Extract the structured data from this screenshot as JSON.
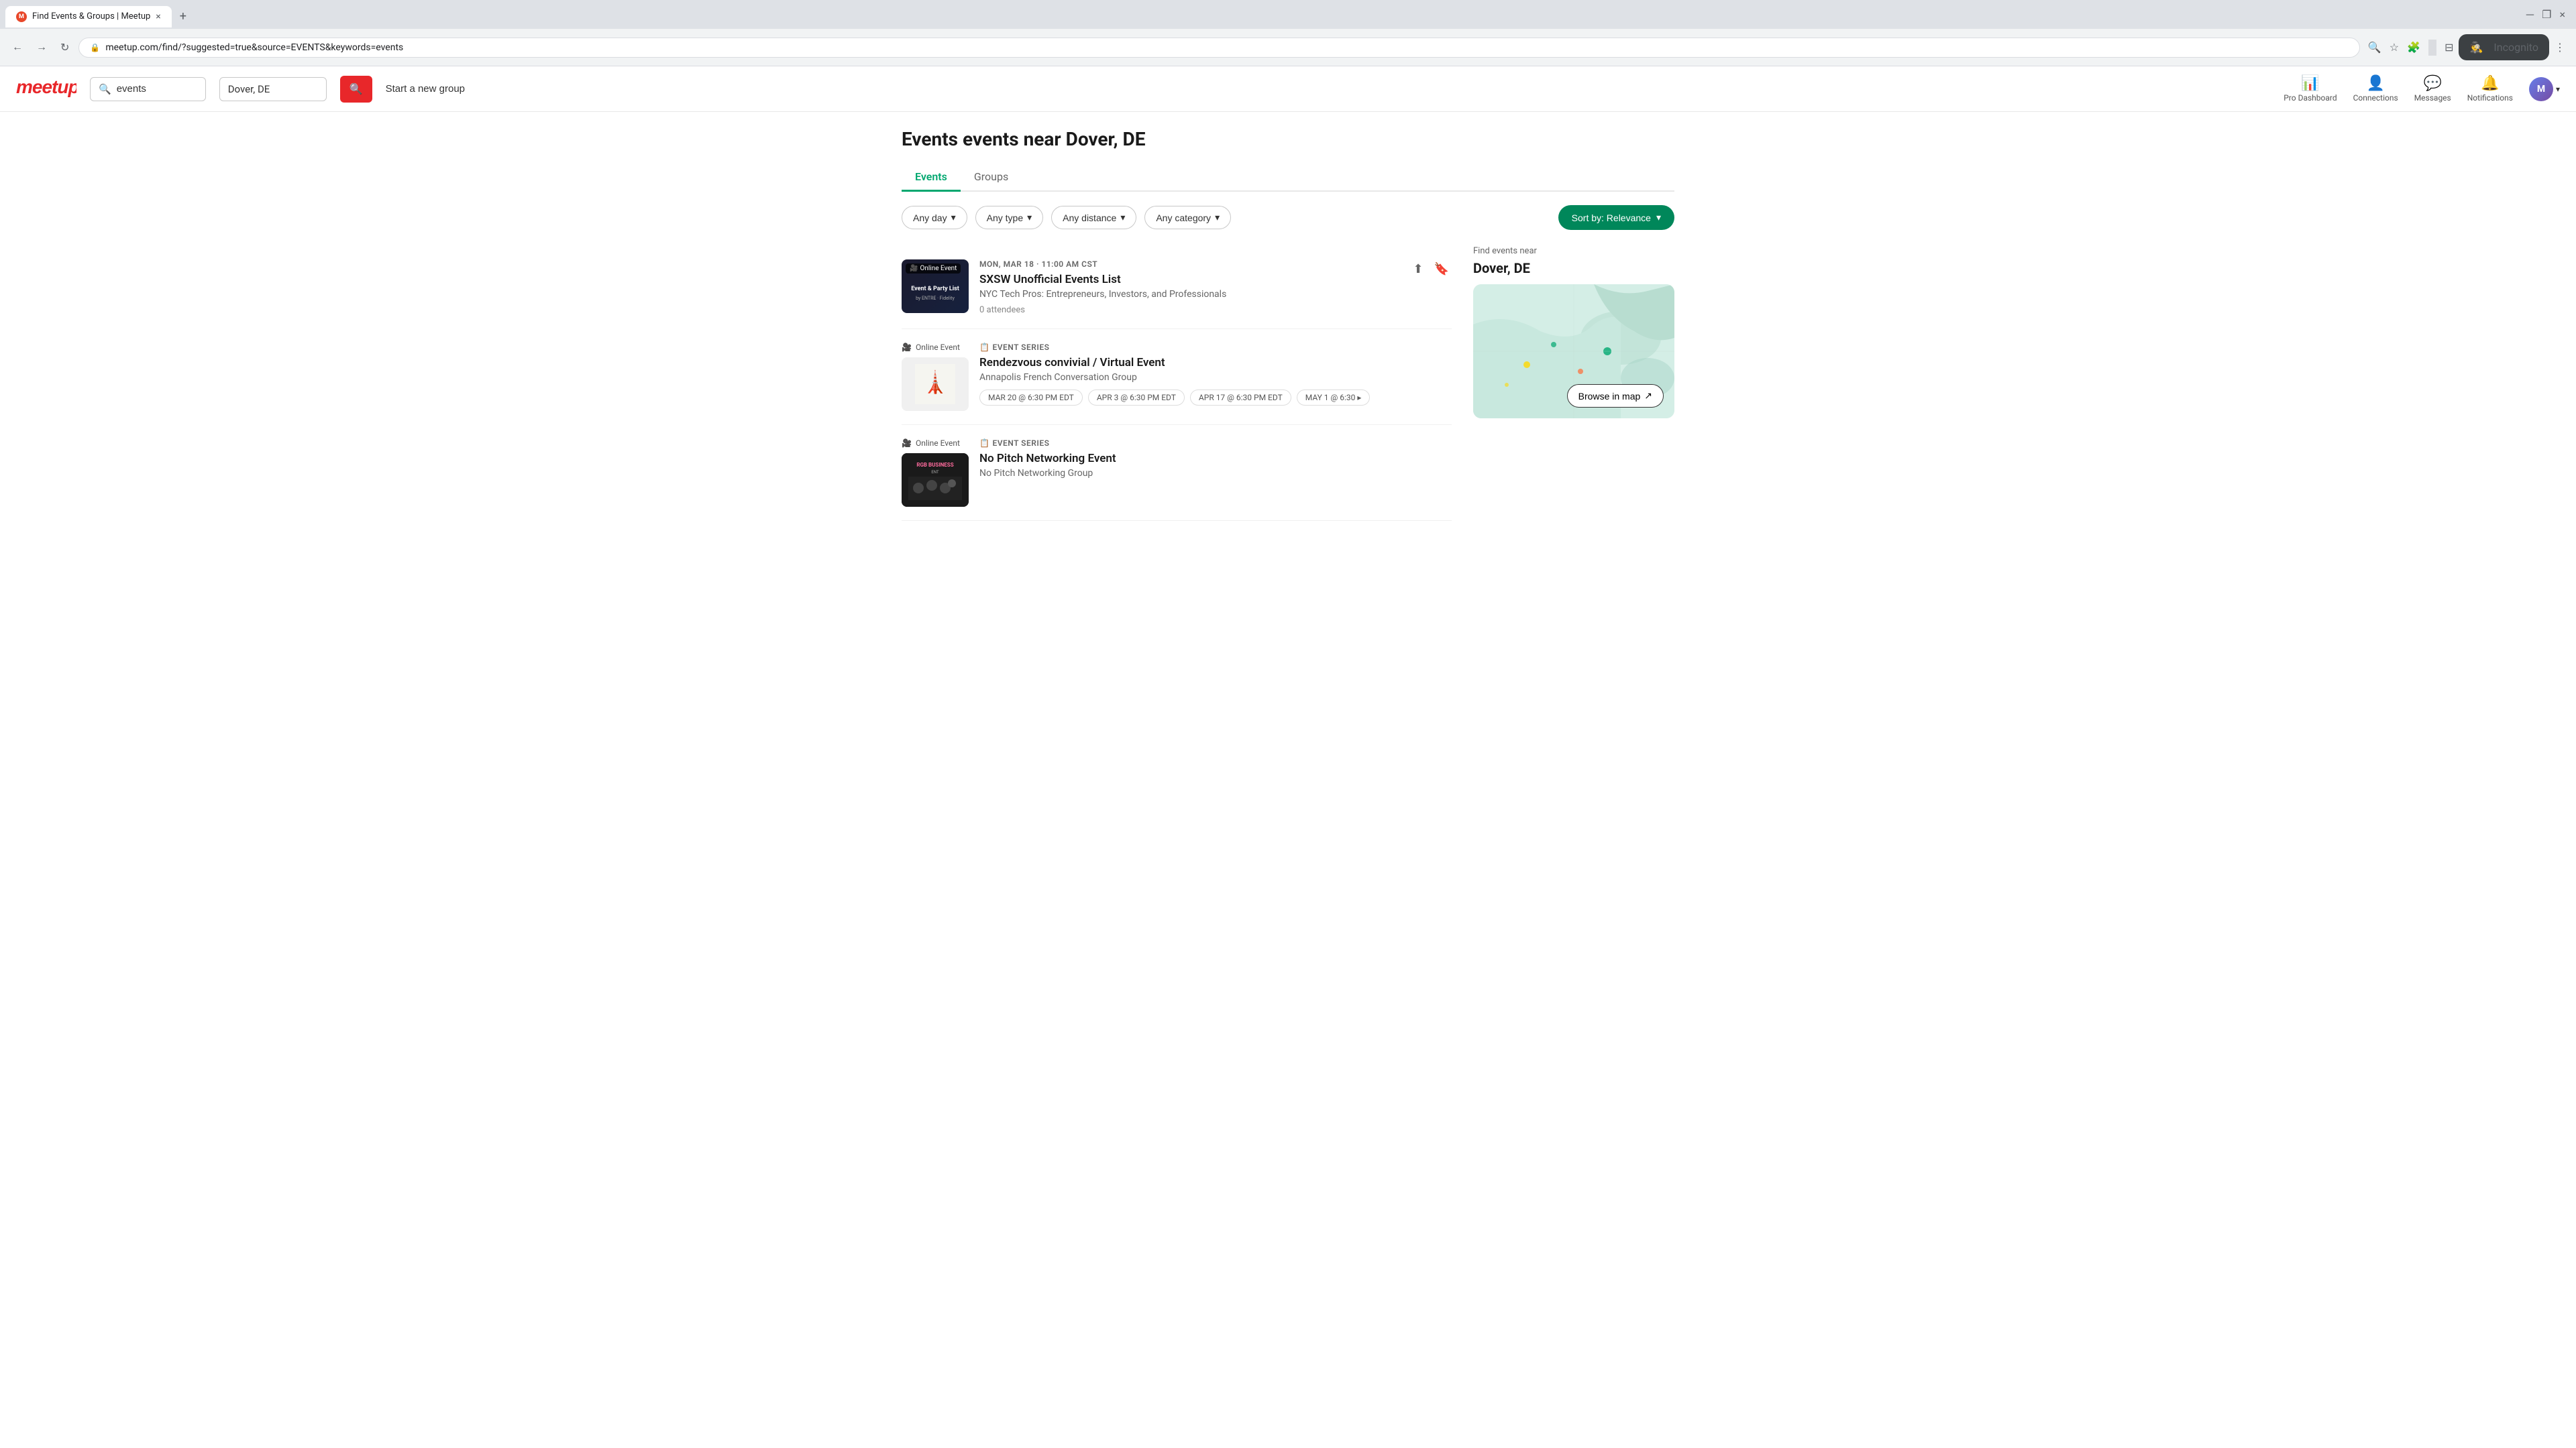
{
  "browser": {
    "tab_favicon": "M",
    "tab_title": "Find Events & Groups | Meetup",
    "tab_close": "×",
    "new_tab": "+",
    "window_minimize": "─",
    "window_maximize": "❐",
    "window_close": "×",
    "url": "meetup.com/find/?suggested=true&source=EVENTS&keywords=events",
    "back_arrow": "←",
    "forward_arrow": "→",
    "refresh_icon": "↻",
    "search_icon": "🔍",
    "star_icon": "☆",
    "extensions_icon": "🧩",
    "split_icon": "⊟",
    "incognito_label": "Incognito",
    "more_icon": "⋮"
  },
  "header": {
    "logo": "meetup",
    "search_placeholder": "events",
    "search_value": "events",
    "location_value": "Dover, DE",
    "search_btn_icon": "🔍",
    "start_group_label": "Start a new group",
    "nav_items": [
      {
        "id": "pro-dashboard",
        "icon": "📊",
        "label": "Pro Dashboard"
      },
      {
        "id": "connections",
        "icon": "👤",
        "label": "Connections"
      },
      {
        "id": "messages",
        "icon": "💬",
        "label": "Messages"
      },
      {
        "id": "notifications",
        "icon": "🔔",
        "label": "Notifications"
      }
    ],
    "user_initial": "M",
    "user_chevron": "▾"
  },
  "page": {
    "title": "Events events near Dover, DE",
    "tabs": [
      {
        "id": "events",
        "label": "Events",
        "active": true
      },
      {
        "id": "groups",
        "label": "Groups",
        "active": false
      }
    ],
    "filters": [
      {
        "id": "day",
        "label": "Any day",
        "has_chevron": true
      },
      {
        "id": "type",
        "label": "Any type",
        "has_chevron": true
      },
      {
        "id": "distance",
        "label": "Any distance",
        "has_chevron": true
      },
      {
        "id": "category",
        "label": "Any category",
        "has_chevron": true
      }
    ],
    "sort_label": "Sort by: Relevance",
    "sort_chevron": "▾"
  },
  "events": [
    {
      "id": "sxsw",
      "type": "single",
      "online_badge": "Online Event",
      "date": "MON, MAR 18 · 11:00 AM CST",
      "title": "SXSW Unofficial Events List",
      "subtitle": "NYC Tech Pros: Entrepreneurs, Investors, and Professionals",
      "attendees": "0 attendees",
      "has_share": true,
      "has_bookmark": true,
      "thumb_type": "party-list"
    },
    {
      "id": "rendezvous",
      "type": "series",
      "series_label": "EVENT SERIES",
      "online_badge": "Online Event",
      "title": "Rendezvous convivial / Virtual Event",
      "subtitle": "Annapolis French Conversation Group",
      "date_pills": [
        "MAR 20 @ 6:30 PM EDT",
        "APR 3 @ 6:30 PM EDT",
        "APR 17 @ 6:30 PM EDT",
        "MAY 1 @ 6:30 ▸"
      ],
      "thumb_type": "french"
    },
    {
      "id": "networking",
      "type": "series",
      "series_label": "EVENT SERIES",
      "online_badge": "Online Event",
      "title": "No Pitch Networking Event",
      "subtitle": "No Pitch Networking Group",
      "thumb_type": "networking"
    }
  ],
  "map": {
    "find_label": "Find events near",
    "location": "Dover, DE",
    "browse_btn": "Browse in map",
    "browse_icon": "↗"
  }
}
